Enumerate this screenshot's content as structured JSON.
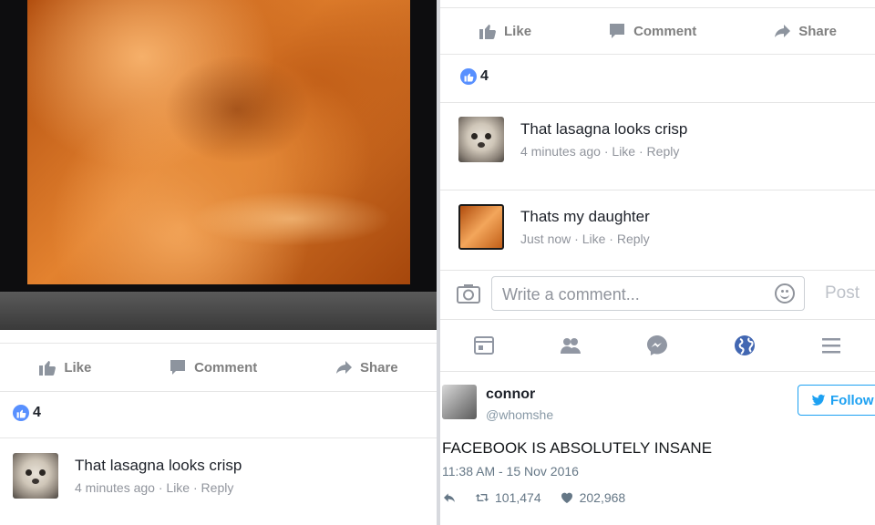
{
  "actions": {
    "like": "Like",
    "comment": "Comment",
    "share": "Share"
  },
  "left": {
    "likes_count": "4",
    "comment": {
      "text": "That lasagna looks crisp",
      "time": "4 minutes ago",
      "like": "Like",
      "reply": "Reply"
    }
  },
  "right": {
    "likes_count": "4",
    "comments": [
      {
        "text": "That lasagna looks crisp",
        "time": "4 minutes ago",
        "like": "Like",
        "reply": "Reply"
      },
      {
        "text": "Thats my daughter",
        "time": "Just now",
        "like": "Like",
        "reply": "Reply"
      }
    ],
    "composer": {
      "placeholder": "Write a comment...",
      "post": "Post"
    },
    "tabs": [
      "feed-icon",
      "friends-icon",
      "messenger-icon",
      "globe-icon",
      "menu-icon"
    ],
    "active_tab_color": "#4267b2"
  },
  "tweet": {
    "name": "connor",
    "handle": "@whomshe",
    "follow": "Follow",
    "text": "FACEBOOK IS ABSOLUTELY INSANE",
    "timestamp": "11:38 AM - 15 Nov 2016",
    "retweets": "101,474",
    "likes": "202,968"
  }
}
